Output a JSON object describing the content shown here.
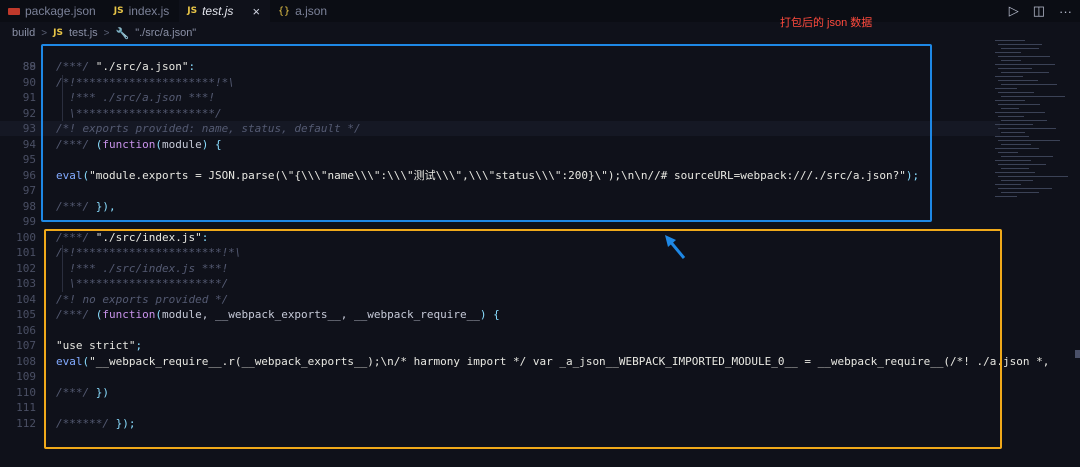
{
  "tabs": [
    {
      "label": "package.json",
      "icon": "npm-package-icon",
      "active": false
    },
    {
      "label": "index.js",
      "icon": "js-file-icon",
      "active": false
    },
    {
      "label": "test.js",
      "icon": "js-file-icon",
      "active": true
    },
    {
      "label": "a.json",
      "icon": "json-file-icon",
      "active": false
    }
  ],
  "tab_close_glyph": "×",
  "icon_text": {
    "js": "JS",
    "json": "{}"
  },
  "actions": {
    "run": "▷",
    "split": "◫",
    "more": "···"
  },
  "annotation": "打包后的 json 数据",
  "breadcrumb": {
    "folder": "build",
    "file": "test.js",
    "symbol": "\"./src/a.json\""
  },
  "code_lines": [
    {
      "n": 89,
      "tokens": [
        [
          "c-com",
          "/***/ "
        ],
        [
          "c-str",
          "\"./src/a.json\""
        ],
        [
          "c-pun",
          ":"
        ]
      ]
    },
    {
      "n": 90,
      "tokens": [
        [
          "c-com",
          "/*!*********************!*\\"
        ]
      ]
    },
    {
      "n": 91,
      "tokens": [
        [
          "c-com",
          "  !*** ./src/a.json ***!"
        ]
      ]
    },
    {
      "n": 92,
      "tokens": [
        [
          "c-com",
          "  \\*********************/"
        ]
      ]
    },
    {
      "n": 93,
      "tokens": [
        [
          "c-com",
          "/*! exports provided: name, status, default */"
        ]
      ]
    },
    {
      "n": 94,
      "tokens": [
        [
          "c-com",
          "/***/ "
        ],
        [
          "c-pun",
          "("
        ],
        [
          "c-kw",
          "function"
        ],
        [
          "c-pun",
          "("
        ],
        [
          "c-def",
          "module"
        ],
        [
          "c-pun",
          ") {"
        ]
      ]
    },
    {
      "n": 95,
      "tokens": []
    },
    {
      "n": 96,
      "tokens": [
        [
          "c-fn",
          "eval"
        ],
        [
          "c-pun",
          "("
        ],
        [
          "c-str",
          "\"module.exports = JSON.parse(\\\"{\\\\\\\"name\\\\\\\":\\\\\\\"测试\\\\\\\",\\\\\\\"status\\\\\\\":200}\\\");\\n\\n//# sourceURL=webpack:///./src/a.json?\""
        ],
        [
          "c-pun",
          ");"
        ]
      ]
    },
    {
      "n": 97,
      "tokens": []
    },
    {
      "n": 98,
      "tokens": [
        [
          "c-com",
          "/***/ "
        ],
        [
          "c-pun",
          "}),"
        ]
      ]
    },
    {
      "n": 99,
      "tokens": []
    },
    {
      "n": 100,
      "tokens": [
        [
          "c-com",
          "/***/ "
        ],
        [
          "c-str",
          "\"./src/index.js\""
        ],
        [
          "c-pun",
          ":"
        ]
      ]
    },
    {
      "n": 101,
      "tokens": [
        [
          "c-com",
          "/*!**********************!*\\"
        ]
      ]
    },
    {
      "n": 102,
      "tokens": [
        [
          "c-com",
          "  !*** ./src/index.js ***!"
        ]
      ]
    },
    {
      "n": 103,
      "tokens": [
        [
          "c-com",
          "  \\**********************/"
        ]
      ]
    },
    {
      "n": 104,
      "tokens": [
        [
          "c-com",
          "/*! no exports provided */"
        ]
      ]
    },
    {
      "n": 105,
      "tokens": [
        [
          "c-com",
          "/***/ "
        ],
        [
          "c-pun",
          "("
        ],
        [
          "c-kw",
          "function"
        ],
        [
          "c-pun",
          "("
        ],
        [
          "c-def",
          "module, __webpack_exports__, __webpack_require__"
        ],
        [
          "c-pun",
          ") {"
        ]
      ]
    },
    {
      "n": 106,
      "tokens": []
    },
    {
      "n": 107,
      "tokens": [
        [
          "c-str",
          "\"use strict\""
        ],
        [
          "c-pun",
          ";"
        ]
      ]
    },
    {
      "n": 108,
      "tokens": [
        [
          "c-fn",
          "eval"
        ],
        [
          "c-pun",
          "("
        ],
        [
          "c-str",
          "\"__webpack_require__.r(__webpack_exports__);\\n/* harmony import */ var _a_json__WEBPACK_IMPORTED_MODULE_0__ = __webpack_require__(/*! ./a.json *,"
        ]
      ]
    },
    {
      "n": 109,
      "tokens": []
    },
    {
      "n": 110,
      "tokens": [
        [
          "c-com",
          "/***/ "
        ],
        [
          "c-pun",
          "})"
        ]
      ]
    },
    {
      "n": 111,
      "tokens": []
    },
    {
      "n": 112,
      "tokens": [
        [
          "c-com",
          "/******/ "
        ],
        [
          "c-pun",
          "});"
        ]
      ]
    }
  ],
  "partial_line_number": "88",
  "current_line": 93,
  "colors": {
    "blue_box": "#1e88e5",
    "orange_box": "#f0a91a",
    "annotation": "#ff4a3d",
    "arrow": "#1e88e5"
  }
}
